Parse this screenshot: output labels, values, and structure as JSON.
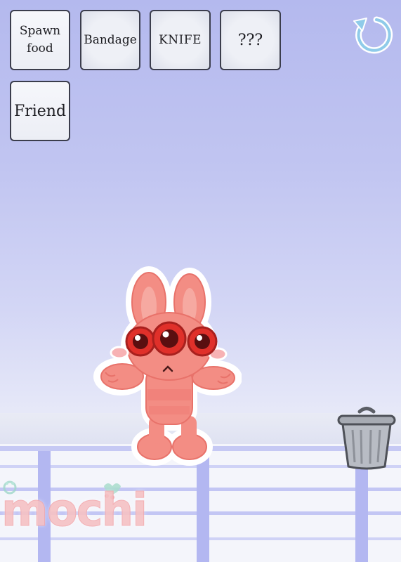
{
  "toolbar": {
    "spawn_food_label": "Spawn\nfood",
    "bandage_label": "Bandage",
    "knife_label": "KNIFE",
    "mystery_label": "???",
    "friend_label": "Friend"
  },
  "controls": {
    "reset_icon": "refresh-icon",
    "trash_icon": "trash-can-icon"
  },
  "character": {
    "name": "pink-three-eyed-bunny"
  },
  "watermark": {
    "logo_text": "mochi"
  },
  "colors": {
    "sky_top": "#b4b9ee",
    "sky_bottom": "#ebedf6",
    "button_border": "#3b3d4c",
    "character_body": "#f38d84",
    "character_eyes": "#e0302a",
    "railing": "#b9bdf3",
    "reset_icon": "#8fcbe9"
  }
}
